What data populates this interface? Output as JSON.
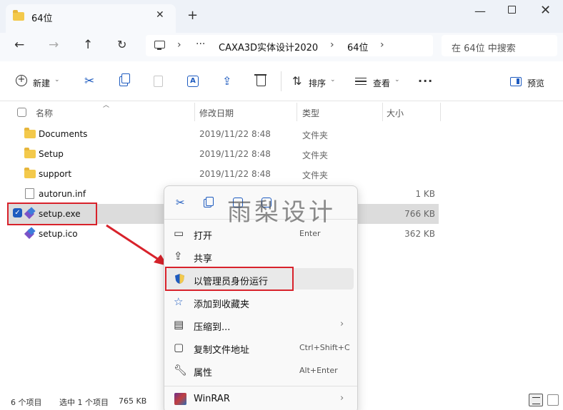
{
  "window": {
    "tab_title": "64位",
    "new_tab": "+",
    "close_tab": "✕"
  },
  "address": {
    "more": "···",
    "crumbs": [
      "CAXA3D实体设计2020",
      "64位"
    ],
    "search_placeholder": "在 64位 中搜索"
  },
  "toolbar": {
    "new_label": "新建",
    "sort_label": "排序",
    "view_label": "查看",
    "more": "···",
    "preview_label": "预览"
  },
  "columns": {
    "name": "名称",
    "date": "修改日期",
    "type": "类型",
    "size": "大小"
  },
  "files": [
    {
      "name": "Documents",
      "date": "2019/11/22 8:48",
      "type": "文件夹",
      "size": ""
    },
    {
      "name": "Setup",
      "date": "2019/11/22 8:48",
      "type": "文件夹",
      "size": ""
    },
    {
      "name": "support",
      "date": "2019/11/22 8:48",
      "type": "文件夹",
      "size": ""
    },
    {
      "name": "autorun.inf",
      "date": "",
      "type": "",
      "size": "1 KB"
    },
    {
      "name": "setup.exe",
      "date": "",
      "type": "",
      "size": "766 KB"
    },
    {
      "name": "setup.ico",
      "date": "",
      "type": "",
      "size": "362 KB"
    }
  ],
  "context_menu": {
    "items": [
      {
        "label": "打开",
        "shortcut": "Enter"
      },
      {
        "label": "共享",
        "shortcut": ""
      },
      {
        "label": "以管理员身份运行",
        "shortcut": ""
      },
      {
        "label": "添加到收藏夹",
        "shortcut": ""
      },
      {
        "label": "压缩到...",
        "shortcut": ""
      },
      {
        "label": "复制文件地址",
        "shortcut": "Ctrl+Shift+C"
      },
      {
        "label": "属性",
        "shortcut": "Alt+Enter"
      },
      {
        "label": "WinRAR",
        "shortcut": ""
      }
    ]
  },
  "watermark": "雨梨设计",
  "status": {
    "count": "6 个项目",
    "selected": "选中 1 个项目",
    "size": "765 KB"
  },
  "colors": {
    "accent": "#1e5bbf",
    "annotation_red": "#d8222b",
    "folder": "#f3c94b"
  }
}
